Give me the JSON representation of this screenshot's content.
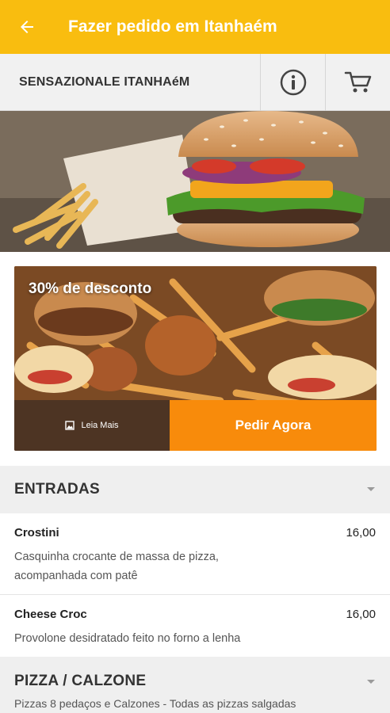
{
  "appbar": {
    "title": "Fazer pedido em Itanhaém",
    "back_icon": "arrow-left-icon"
  },
  "store": {
    "name": "SENSAZIONALE ITANHAéM",
    "info_icon": "info-icon",
    "cart_icon": "cart-icon"
  },
  "promo": {
    "title": "30% de desconto",
    "read_more_label": "Leia Mais",
    "order_label": "Pedir Agora",
    "order_color": "#f88b0b"
  },
  "colors": {
    "accent": "#f9bd0f",
    "section_bg": "#efefef"
  },
  "sections": [
    {
      "title": "ENTRADAS",
      "items": [
        {
          "name": "Crostini",
          "price": "16,00",
          "desc_line1": "Casquinha crocante de massa de pizza,",
          "desc_line2": "acompanhada com patê"
        },
        {
          "name": "Cheese Croc",
          "price": "16,00",
          "desc_line1": "Provolone desidratado feito no forno a lenha"
        }
      ]
    },
    {
      "title": "PIZZA / CALZONE",
      "description": "Pizzas 8 pedaços e Calzones - Todas as pizzas salgadas"
    }
  ]
}
